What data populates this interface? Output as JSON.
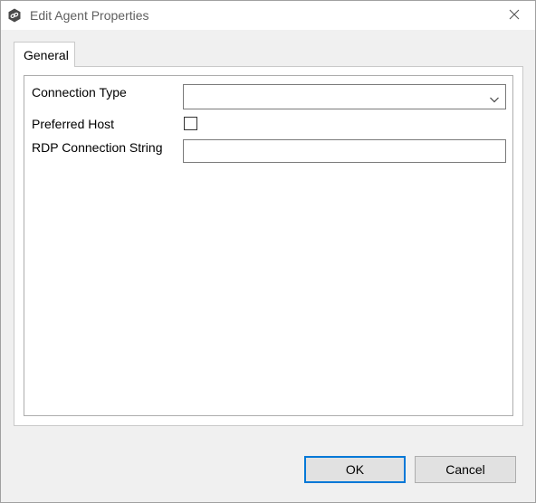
{
  "window": {
    "title": "Edit Agent Properties",
    "icons": {
      "app": "app-logo-icon",
      "close": "close-icon"
    }
  },
  "tabs": [
    {
      "label": "General",
      "selected": true
    }
  ],
  "form": {
    "connection_type": {
      "label": "Connection Type",
      "value": "",
      "icon": "chevron-down-icon"
    },
    "preferred_host": {
      "label": "Preferred Host",
      "checked": false
    },
    "rdp_connection_string": {
      "label": "RDP Connection String",
      "value": ""
    }
  },
  "buttons": {
    "ok": "OK",
    "cancel": "Cancel"
  },
  "colors": {
    "accent": "#0078d7",
    "window_bg": "#f0f0f0",
    "button_bg": "#e1e1e1"
  }
}
